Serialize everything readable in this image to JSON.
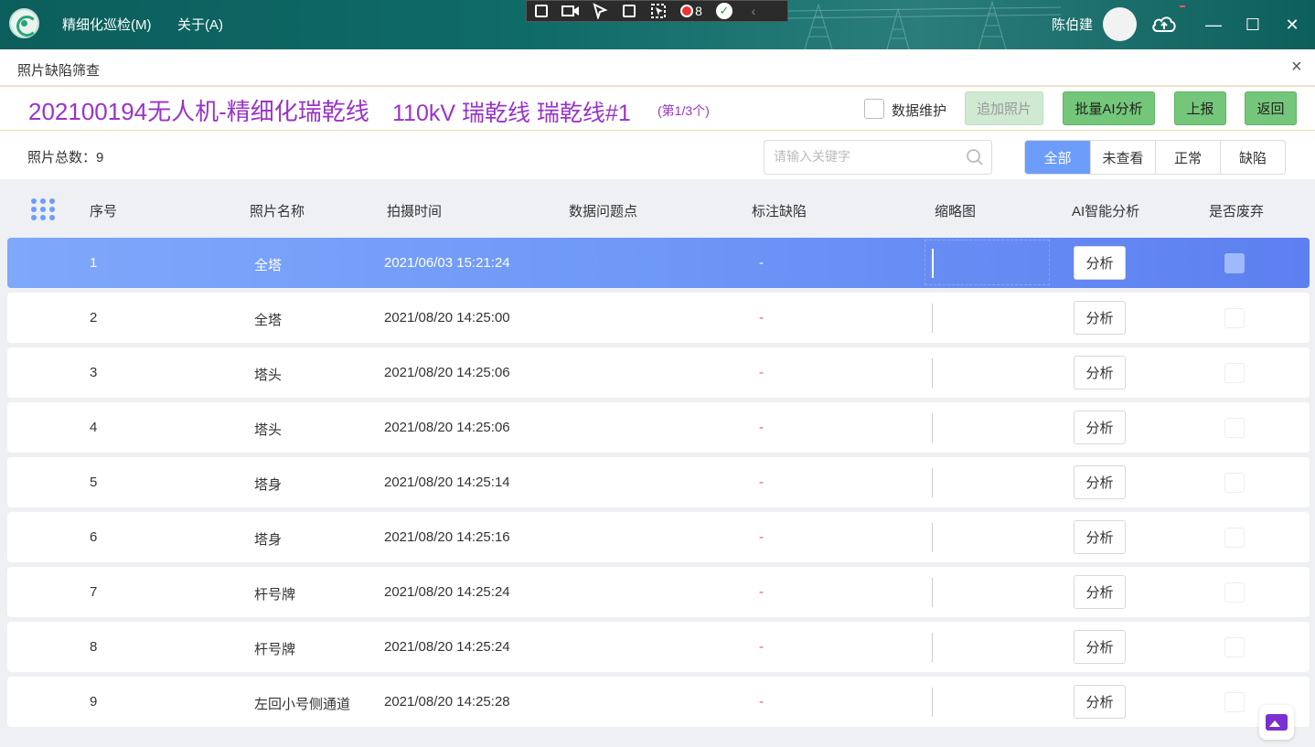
{
  "titlebar": {
    "menu": [
      "精细化巡检(M)",
      "关于(A)"
    ],
    "capture_count": "8",
    "username": "陈伯建"
  },
  "panel": {
    "title": "照片缺陷筛查"
  },
  "info": {
    "task": "202100194无人机-精细化瑞乾线",
    "line": "110kV 瑞乾线 瑞乾线#1",
    "position": "(第1/3个)",
    "maintain_label": "数据维护",
    "buttons": {
      "add_photo": "追加照片",
      "batch_ai": "批量AI分析",
      "report": "上报",
      "back": "返回"
    }
  },
  "filter": {
    "total": "照片总数：9",
    "search_placeholder": "请输入关键字",
    "tabs": [
      "全部",
      "未查看",
      "正常",
      "缺陷"
    ],
    "active_tab": "全部"
  },
  "table": {
    "headers": [
      "序号",
      "照片名称",
      "拍摄时间",
      "数据问题点",
      "标注缺陷",
      "缩略图",
      "AI智能分析",
      "是否废弃"
    ],
    "analyze_label": "分析",
    "dash": "-",
    "rows": [
      {
        "no": "1",
        "name": "全塔",
        "time": "2021/06/03 15:21:24"
      },
      {
        "no": "2",
        "name": "全塔",
        "time": "2021/08/20 14:25:00"
      },
      {
        "no": "3",
        "name": "塔头",
        "time": "2021/08/20 14:25:06"
      },
      {
        "no": "4",
        "name": "塔头",
        "time": "2021/08/20 14:25:06"
      },
      {
        "no": "5",
        "name": "塔身",
        "time": "2021/08/20 14:25:14"
      },
      {
        "no": "6",
        "name": "塔身",
        "time": "2021/08/20 14:25:16"
      },
      {
        "no": "7",
        "name": "杆号牌",
        "time": "2021/08/20 14:25:24"
      },
      {
        "no": "8",
        "name": "杆号牌",
        "time": "2021/08/20 14:25:24"
      },
      {
        "no": "9",
        "name": "左回小号侧通道",
        "time": "2021/08/20 14:25:28"
      }
    ],
    "selected_row": 0
  },
  "colors": {
    "accent": "#6c9dfb",
    "title_purple": "#9a33c8",
    "green_button": "#74c77a",
    "titlebar": "#0f6b68"
  }
}
